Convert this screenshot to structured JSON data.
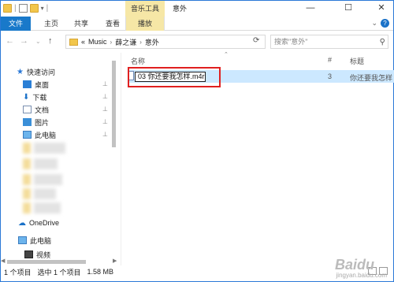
{
  "window": {
    "contextual_tab": "音乐工具",
    "title": "意外",
    "minimize": "—",
    "maximize": "☐",
    "close": "✕"
  },
  "ribbon": {
    "tabs": [
      "文件",
      "主页",
      "共享",
      "查看",
      "播放"
    ]
  },
  "address": {
    "prefix": "«",
    "path": [
      "Music",
      "薛之谦",
      "意外"
    ],
    "search_placeholder": "搜索\"意外\""
  },
  "nav": {
    "quick_access": "快速访问",
    "items": [
      {
        "label": "桌面",
        "icon": "desktop-icon"
      },
      {
        "label": "下载",
        "icon": "download-icon"
      },
      {
        "label": "文档",
        "icon": "documents-icon"
      },
      {
        "label": "图片",
        "icon": "pictures-icon"
      },
      {
        "label": "此电脑",
        "icon": "computer-icon"
      }
    ],
    "onedrive": "OneDrive",
    "this_pc": "此电脑",
    "videos": "视频"
  },
  "list": {
    "columns": {
      "name": "名称",
      "number": "#",
      "title": "标题"
    },
    "rows": [
      {
        "name": "03 你还要我怎样.m4r",
        "number": "3",
        "title": "你还要我怎样"
      }
    ]
  },
  "status": {
    "count": "1 个项目",
    "selected": "选中 1 个项目",
    "size": "1.58 MB"
  },
  "watermark": {
    "brand": "Baidu",
    "caption": "jingyan.baidu.com"
  },
  "colors": {
    "accent": "#1979ca",
    "context_tab": "#f6e7a6",
    "selection": "#cce8ff",
    "highlight_box": "#e02020"
  }
}
